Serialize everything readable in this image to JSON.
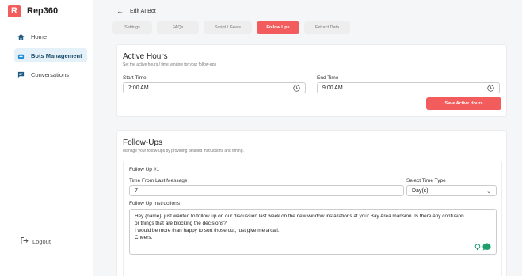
{
  "brand": {
    "mark": "R",
    "name": "Rep360"
  },
  "sidebar": {
    "items": [
      {
        "label": "Home",
        "icon": "home-icon",
        "active": false
      },
      {
        "label": "Bots Management",
        "icon": "bot-icon",
        "active": true
      },
      {
        "label": "Conversations",
        "icon": "chat-icon",
        "active": false
      }
    ],
    "logout_label": "Logout"
  },
  "header": {
    "back_label": "Edit AI Bot"
  },
  "tabs": [
    {
      "label": "Settings",
      "active": false
    },
    {
      "label": "FAQs",
      "active": false
    },
    {
      "label": "Script / Goals",
      "active": false
    },
    {
      "label": "Follow Ups",
      "active": true
    },
    {
      "label": "Extract Data",
      "active": false
    }
  ],
  "active_hours": {
    "title": "Active Hours",
    "subtitle": "Set the active hours / time window for your follow-ups",
    "start_label": "Start Time",
    "start_value": "7:00 AM",
    "end_label": "End Time",
    "end_value": "9:00 AM",
    "save_label": "Save Active Hours"
  },
  "follow_ups": {
    "title": "Follow-Ups",
    "subtitle": "Manage your follow-ups by providing detailed instructions and timing.",
    "item": {
      "heading": "Follow Up #1",
      "time_label": "Time From Last Message",
      "time_value": "7",
      "type_label": "Select Time Type",
      "type_value": "Day(s)",
      "instructions_label": "Follow Up Instructions",
      "instructions_lines": [
        "Hey {name}, just wanted to follow up on our discussion last week on the new window installations at your Bay Area mansion. Is there any confusion",
        "or things that are blocking the decisions?",
        "I would be more than happy to sort those out, just give me a call.",
        "Cheers."
      ]
    }
  },
  "colors": {
    "accent": "#f25c5c",
    "sidebar_active_bg": "#e4f1f8",
    "sidebar_icon": "#1e5a80"
  }
}
